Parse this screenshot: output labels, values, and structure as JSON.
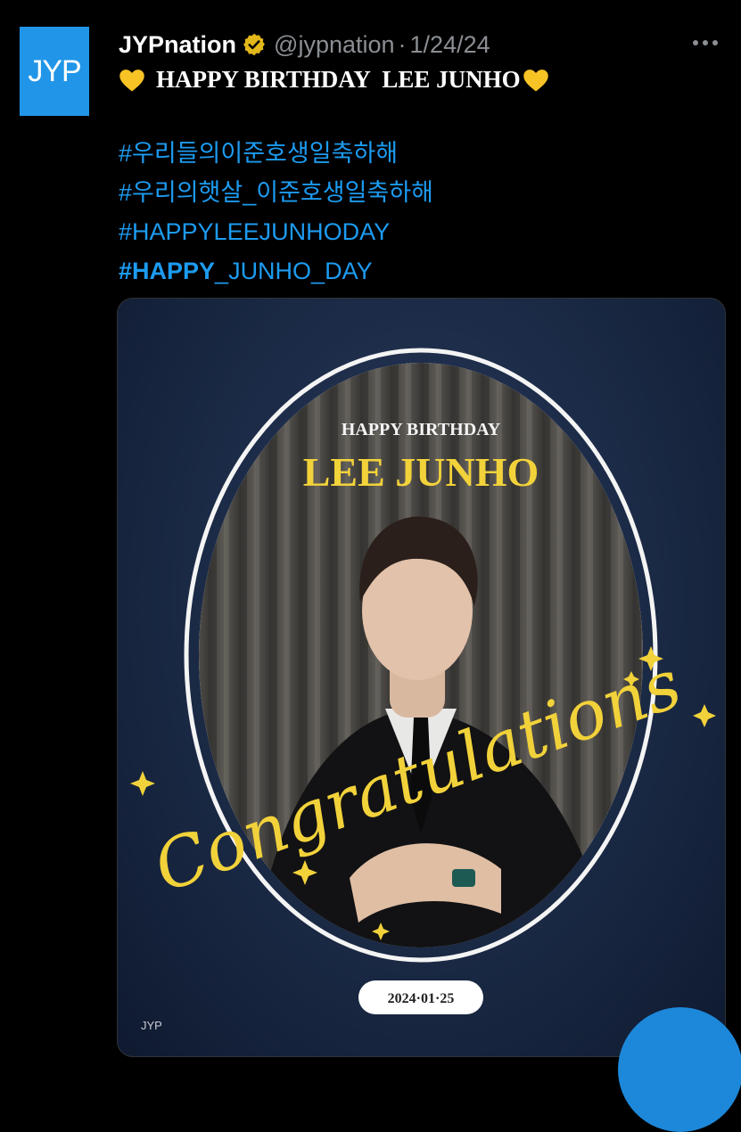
{
  "account": {
    "logo_text": "JYP",
    "display_name": "JYPnation",
    "handle": "@jypnation",
    "separator": "·",
    "date": "1/24/24"
  },
  "tweet": {
    "title": "HAPPY BIRTHDAY  LEE JUNHO",
    "hashtags": [
      "#우리들의이준호생일축하해",
      "#우리의햇살_이준호생일축하해",
      "#HAPPYLEEJUNHODAY"
    ],
    "hashtag_last_bold": "#HAPPY",
    "hashtag_last_rest": "_JUNHO_DAY"
  },
  "poster": {
    "header": "HAPPY BIRTHDAY",
    "name": "LEE JUNHO",
    "script": "Congratulations",
    "date": "2024·01·25",
    "brand": "JYP"
  },
  "colors": {
    "background": "#000000",
    "link": "#1d9bf0",
    "poster_bg": "#1a2944",
    "gold": "#f2d23a",
    "avatar": "#2196e8"
  }
}
